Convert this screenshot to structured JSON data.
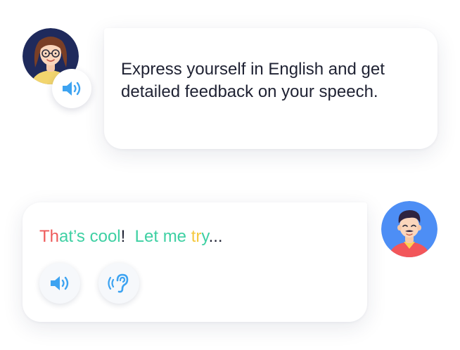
{
  "colors": {
    "accent_blue": "#3da3f1",
    "text_dark": "#1f2233",
    "reply_red": "#ee5a5a",
    "reply_green": "#3ed0a3",
    "reply_yellow": "#f5c940"
  },
  "teacher_message": {
    "line1": "Express yourself in English and get",
    "line2": "detailed feedback on your speech."
  },
  "reply": {
    "segments": [
      {
        "text": "Th",
        "color": "#ee5a5a"
      },
      {
        "text": "at’s",
        "color": "#3ed0a3"
      },
      {
        "text": " ",
        "color": "#1f2233"
      },
      {
        "text": "cool",
        "color": "#3ed0a3"
      },
      {
        "text": "!",
        "color": "#1f2233"
      },
      {
        "text": "  ",
        "color": "#1f2233"
      },
      {
        "text": "Let me",
        "color": "#3ed0a3"
      },
      {
        "text": " ",
        "color": "#1f2233"
      },
      {
        "text": "tr",
        "color": "#f5c940"
      },
      {
        "text": "y",
        "color": "#3ed0a3"
      },
      {
        "text": "...",
        "color": "#1f2233"
      }
    ]
  },
  "icons": {
    "teacher_speaker": "speaker-icon",
    "play": "speaker-icon",
    "listen": "ear-icon"
  }
}
